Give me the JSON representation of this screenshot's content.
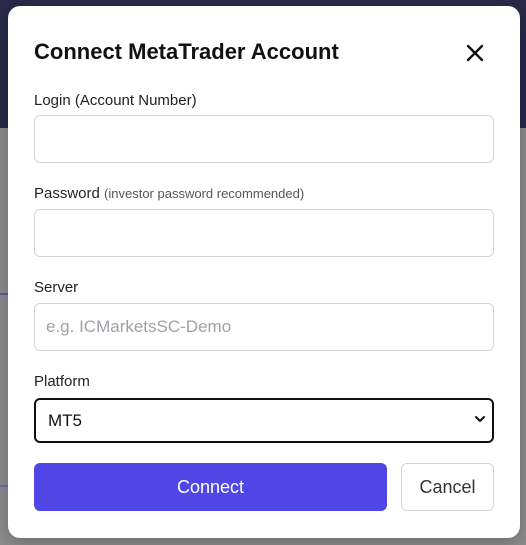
{
  "modal": {
    "title": "Connect MetaTrader Account",
    "close_icon": "close-icon"
  },
  "fields": {
    "login": {
      "label": "Login (Account Number)",
      "value": "",
      "placeholder": ""
    },
    "password": {
      "label": "Password",
      "hint": "(investor password recommended)",
      "value": "",
      "placeholder": ""
    },
    "server": {
      "label": "Server",
      "value": "",
      "placeholder": "e.g. ICMarketsSC-Demo"
    },
    "platform": {
      "label": "Platform",
      "selected": "MT5",
      "chevron_icon": "chevron-down-icon"
    }
  },
  "actions": {
    "connect_label": "Connect",
    "cancel_label": "Cancel"
  },
  "colors": {
    "primary": "#5046e5",
    "backdrop_top": "#2b2b4a",
    "backdrop": "#8d8d8d"
  }
}
